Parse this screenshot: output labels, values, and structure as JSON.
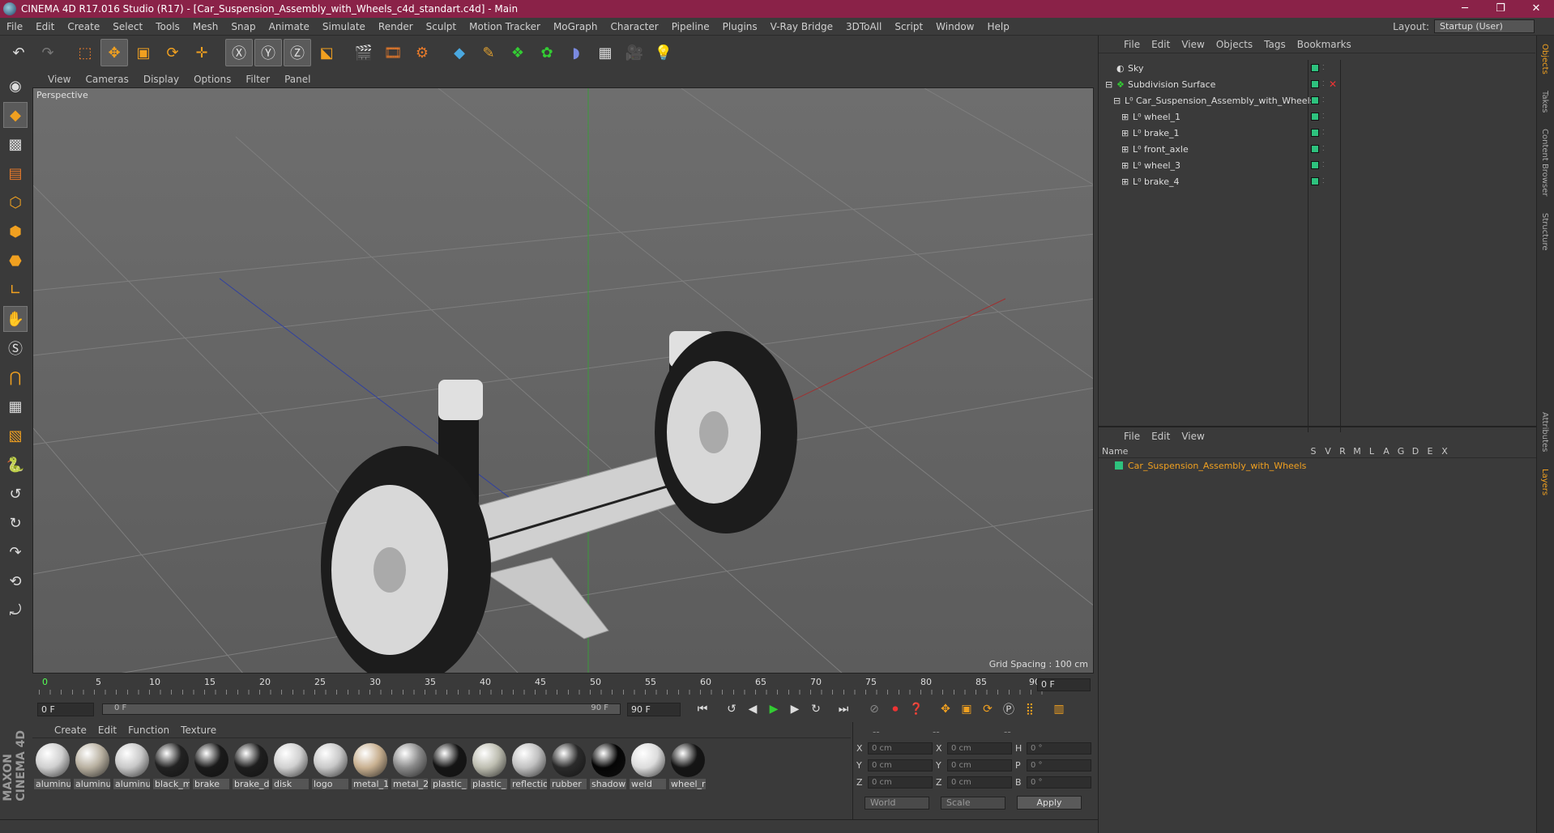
{
  "window": {
    "title": "CINEMA 4D R17.016 Studio (R17) - [Car_Suspension_Assembly_with_Wheels_c4d_standart.c4d] - Main",
    "minimize": "─",
    "maximize": "❐",
    "close": "✕"
  },
  "menubar": {
    "items": [
      "File",
      "Edit",
      "Create",
      "Select",
      "Tools",
      "Mesh",
      "Snap",
      "Animate",
      "Simulate",
      "Render",
      "Sculpt",
      "Motion Tracker",
      "MoGraph",
      "Character",
      "Pipeline",
      "Plugins",
      "V-Ray Bridge",
      "3DToAll",
      "Script",
      "Window",
      "Help"
    ],
    "layout_label": "Layout:",
    "layout_value": "Startup (User)"
  },
  "viewport": {
    "menu": [
      "View",
      "Cameras",
      "Display",
      "Options",
      "Filter",
      "Panel"
    ],
    "label": "Perspective",
    "grid_spacing": "Grid Spacing : 100 cm"
  },
  "timeline": {
    "ticks": [
      "0",
      "5",
      "10",
      "15",
      "20",
      "25",
      "30",
      "35",
      "40",
      "45",
      "50",
      "55",
      "60",
      "65",
      "70",
      "75",
      "80",
      "85",
      "90"
    ],
    "current_frame": "0 F"
  },
  "transport": {
    "start_frame": "0 F",
    "range_start": "0 F",
    "range_end": "90 F",
    "end_frame": "90 F"
  },
  "materials": {
    "menu": [
      "Create",
      "Edit",
      "Function",
      "Texture"
    ],
    "items": [
      {
        "name": "aluminu",
        "color": "#cfcfcf"
      },
      {
        "name": "aluminu",
        "color": "#b8b0a0"
      },
      {
        "name": "aluminu",
        "color": "#c8c8c8"
      },
      {
        "name": "black_m",
        "color": "#222222"
      },
      {
        "name": "brake",
        "color": "#1a1a1a"
      },
      {
        "name": "brake_d",
        "color": "#1e1e1e"
      },
      {
        "name": "disk",
        "color": "#d0d0d0"
      },
      {
        "name": "logo",
        "color": "#c8c8c8"
      },
      {
        "name": "metal_1",
        "color": "#c8b090"
      },
      {
        "name": "metal_2",
        "color": "#8a8a8a"
      },
      {
        "name": "plastic_",
        "color": "#151515"
      },
      {
        "name": "plastic_",
        "color": "#bdbdb0"
      },
      {
        "name": "reflectio",
        "color": "#c0c0c0"
      },
      {
        "name": "rubber",
        "color": "#2a2a2a"
      },
      {
        "name": "shadow",
        "color": "#050505"
      },
      {
        "name": "weld",
        "color": "#dcdcdc"
      },
      {
        "name": "wheel_r",
        "color": "#151515"
      }
    ]
  },
  "coords": {
    "header_1": "--",
    "header_2": "--",
    "header_3": "--",
    "rows": [
      {
        "a1": "X",
        "v1": "0 cm",
        "a2": "X",
        "v2": "0 cm",
        "a3": "H",
        "v3": "0 °"
      },
      {
        "a1": "Y",
        "v1": "0 cm",
        "a2": "Y",
        "v2": "0 cm",
        "a3": "P",
        "v3": "0 °"
      },
      {
        "a1": "Z",
        "v1": "0 cm",
        "a2": "Z",
        "v2": "0 cm",
        "a3": "B",
        "v3": "0 °"
      }
    ],
    "space": "World",
    "mode": "Scale",
    "apply": "Apply"
  },
  "objects": {
    "menu": [
      "File",
      "Edit",
      "View",
      "Objects",
      "Tags",
      "Bookmarks"
    ],
    "items": [
      {
        "name": "Sky",
        "indent": 0
      },
      {
        "name": "Subdivision Surface",
        "indent": 0
      },
      {
        "name": "Car_Suspension_Assembly_with_Wheels",
        "indent": 1
      },
      {
        "name": "wheel_1",
        "indent": 2
      },
      {
        "name": "brake_1",
        "indent": 2
      },
      {
        "name": "front_axle",
        "indent": 2
      },
      {
        "name": "wheel_3",
        "indent": 2
      },
      {
        "name": "brake_4",
        "indent": 2
      }
    ]
  },
  "layers": {
    "menu": [
      "File",
      "Edit",
      "View"
    ],
    "header_name": "Name",
    "columns": [
      "S",
      "V",
      "R",
      "M",
      "L",
      "A",
      "G",
      "D",
      "E",
      "X"
    ],
    "item": "Car_Suspension_Assembly_with_Wheels"
  },
  "side_tabs": [
    "Objects",
    "Takes",
    "Content Browser",
    "Structure",
    "Attributes",
    "Layers"
  ],
  "brand": "MAXON CINEMA 4D"
}
